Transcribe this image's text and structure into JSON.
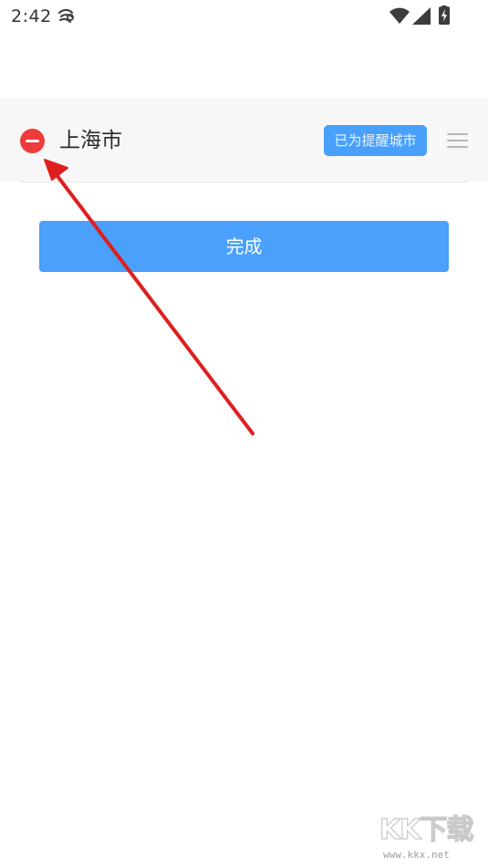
{
  "status_bar": {
    "time": "2:42",
    "icons": [
      "notification-icon",
      "wifi-icon",
      "cell-signal-icon",
      "battery-charging-icon"
    ]
  },
  "city_list": {
    "items": [
      {
        "name": "上海市",
        "badge": "已为提醒城市",
        "delete_icon": "minus-circle-icon",
        "drag_icon": "drag-handle-icon"
      }
    ]
  },
  "actions": {
    "done_label": "完成"
  },
  "watermark": {
    "mark": "KK下载",
    "url": "www.kkx.net"
  },
  "colors": {
    "accent": "#4aa0fb",
    "delete": "#ee3b3b",
    "row_background": "#f7f7f7",
    "annotation": "#e01e1e"
  }
}
